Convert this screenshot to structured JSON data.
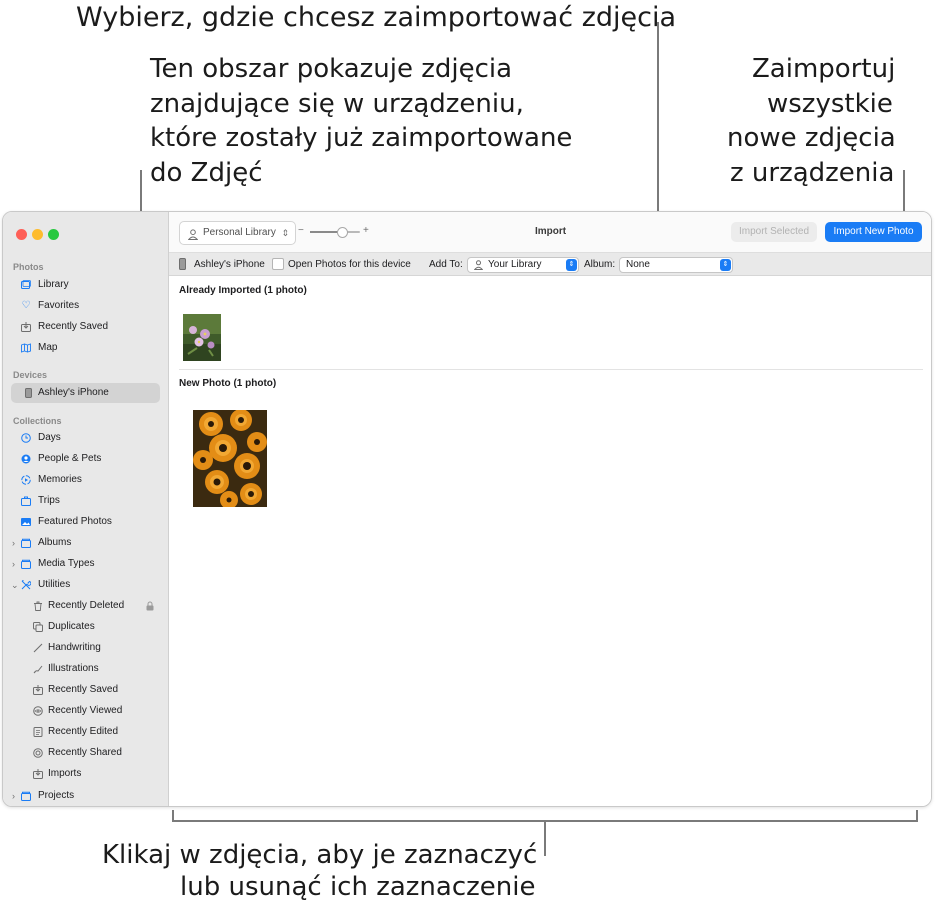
{
  "callouts": {
    "choose_destination": "Wybierz, gdzie chcesz zaimportować zdjęcia",
    "already_imported_lines": [
      "Ten obszar pokazuje zdjęcia",
      "znajdujące się w urządzeniu,",
      "które zostały już zaimportowane",
      "do Zdjęć"
    ],
    "import_all_lines": [
      "Zaimportuj",
      "wszystkie",
      "nowe zdjęcia",
      "z urządzenia"
    ],
    "click_photos_lines": [
      "Klikaj w zdjęcia, aby je zaznaczyć",
      "lub usunąć ich zaznaczenie"
    ]
  },
  "colors": {
    "accent": "#1a7cf5",
    "close": "#fe5f57",
    "minimize": "#febc2e",
    "zoom": "#28c840"
  },
  "sidebar": {
    "photos_header": "Photos",
    "photos_items": [
      {
        "label": "Library",
        "icon": "photo-library-icon"
      },
      {
        "label": "Favorites",
        "icon": "heart-icon"
      },
      {
        "label": "Recently Saved",
        "icon": "tray-download-icon"
      },
      {
        "label": "Map",
        "icon": "map-icon"
      }
    ],
    "devices_header": "Devices",
    "device": {
      "label": "Ashley's iPhone",
      "icon": "iphone-icon"
    },
    "collections_header": "Collections",
    "collection_items": [
      {
        "label": "Days",
        "icon": "clock-icon"
      },
      {
        "label": "People & Pets",
        "icon": "person-circle-icon"
      },
      {
        "label": "Memories",
        "icon": "memories-icon"
      },
      {
        "label": "Trips",
        "icon": "suitcase-icon"
      },
      {
        "label": "Featured Photos",
        "icon": "photo-icon"
      },
      {
        "label": "Albums",
        "icon": "folder-icon"
      },
      {
        "label": "Media Types",
        "icon": "folder-icon"
      },
      {
        "label": "Utilities",
        "icon": "tools-icon"
      }
    ],
    "utility_items": [
      {
        "label": "Recently Deleted",
        "icon": "trash-icon"
      },
      {
        "label": "Duplicates",
        "icon": "duplicate-icon"
      },
      {
        "label": "Handwriting",
        "icon": "pencil-icon"
      },
      {
        "label": "Illustrations",
        "icon": "brush-icon"
      },
      {
        "label": "Recently Saved",
        "icon": "tray-download-icon"
      },
      {
        "label": "Recently Viewed",
        "icon": "eye-icon"
      },
      {
        "label": "Recently Edited",
        "icon": "edit-icon"
      },
      {
        "label": "Recently Shared",
        "icon": "share-circle-icon"
      },
      {
        "label": "Imports",
        "icon": "tray-download-icon"
      }
    ],
    "projects": {
      "label": "Projects",
      "icon": "folder-icon"
    }
  },
  "toolbar": {
    "library_picker": "Personal Library",
    "zoom_minus": "−",
    "zoom_plus": "+",
    "title": "Import",
    "import_selected": "Import Selected",
    "import_new": "Import New Photo"
  },
  "subbar": {
    "device_name": "Ashley's iPhone",
    "open_photos_label": "Open Photos for this device",
    "add_to_label": "Add To:",
    "add_to_value": "Your Library",
    "album_label": "Album:",
    "album_value": "None"
  },
  "content": {
    "already_imported_title": "Already Imported (1 photo)",
    "new_photo_title": "New Photo (1 photo)"
  }
}
